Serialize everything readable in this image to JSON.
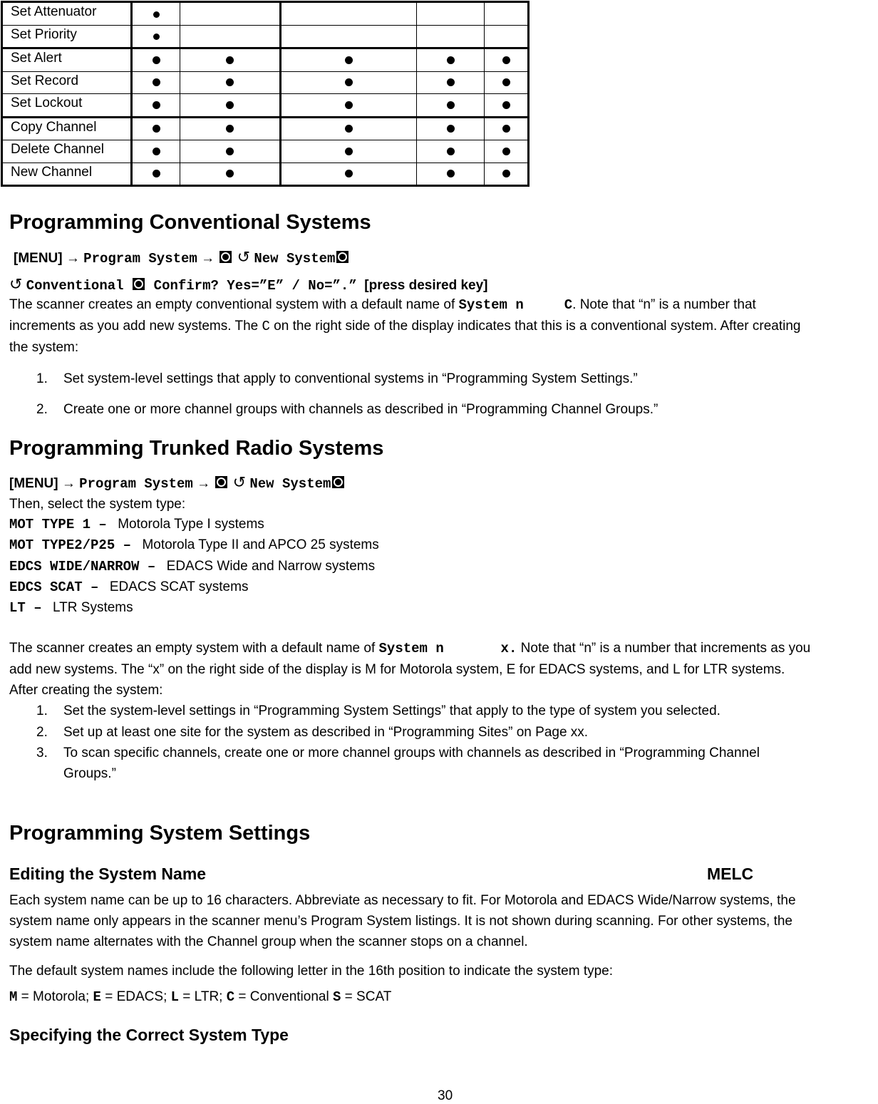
{
  "feature_table": {
    "rows": [
      {
        "label": "Set Attenuator",
        "marks": [
          true,
          false,
          false,
          false,
          false
        ],
        "small": true
      },
      {
        "label": "Set Priority",
        "marks": [
          true,
          false,
          false,
          false,
          false
        ],
        "small": true
      },
      {
        "label": "Set Alert",
        "marks": [
          true,
          true,
          true,
          true,
          true
        ]
      },
      {
        "label": "Set Record",
        "marks": [
          true,
          true,
          true,
          true,
          true
        ]
      },
      {
        "label": "Set Lockout",
        "marks": [
          true,
          true,
          true,
          true,
          true
        ]
      },
      {
        "label": "Copy Channel",
        "marks": [
          true,
          true,
          true,
          true,
          true
        ]
      },
      {
        "label": "Delete Channel",
        "marks": [
          true,
          true,
          true,
          true,
          true
        ]
      },
      {
        "label": "New Channel",
        "marks": [
          true,
          true,
          true,
          true,
          true
        ]
      }
    ]
  },
  "conventional": {
    "heading": "Programming Conventional Systems",
    "menu_key": "[MENU]",
    "arrow": "→",
    "path1": "Program System",
    "path2": "New System",
    "path3": "Conventional",
    "path4": "Confirm? Yes=”E” / No=”.”",
    "press_hint": "[press desired key]",
    "rotate_icon": "↺",
    "para_l1_a": "The scanner creates an empty conventional system with a default name of ",
    "para_l1_code": "System n     C",
    "para_l1_b": ".  Note that “n” is a number that",
    "para_l2_a": "increments as you add new systems. The ",
    "para_l2_code": "C",
    "para_l2_b": " on the right side of the display indicates that this is a conventional system. After creating",
    "para_l3": "the system:",
    "steps": [
      {
        "num": "1.",
        "text": "Set system-level settings that apply to conventional systems in “Programming System Settings.”"
      },
      {
        "num": "2.",
        "text": "Create one or more channel groups with channels as described in “Programming Channel Groups.”"
      }
    ]
  },
  "trunked": {
    "heading": "Programming Trunked Radio Systems",
    "menu_key": "[MENU]",
    "arrow": "→",
    "path1": "Program System",
    "path2": "New System",
    "rotate_icon": "↺",
    "intro": "Then, select the system type:",
    "types": [
      {
        "code": "MOT TYPE 1 – ",
        "desc": "Motorola Type I systems"
      },
      {
        "code": "MOT TYPE2/P25 – ",
        "desc": "Motorola Type II and APCO 25 systems"
      },
      {
        "code": "EDCS WIDE/NARROW – ",
        "desc": "EDACS Wide and Narrow systems"
      },
      {
        "code": "EDCS SCAT – ",
        "desc": "EDACS SCAT systems"
      },
      {
        "code": "LT – ",
        "desc": "LTR Systems"
      }
    ],
    "para_l1_a": "The scanner creates an empty system with a default name of ",
    "para_l1_code": "System n       x.",
    "para_l1_b": " Note that “n” is a number that increments as you",
    "para_l2": "add new systems. The “x” on the right side of the display is M for Motorola system, E for EDACS systems, and L for LTR systems.",
    "para_l3": "After creating the system:",
    "steps": [
      {
        "num": "1.",
        "text": "Set the system-level settings in “Programming System Settings” that apply to the type of system you selected."
      },
      {
        "num": "2.",
        "text": "Set up at least one site for the system as described in “Programming Sites” on Page xx."
      },
      {
        "num": "3.",
        "text": "To scan specific channels, create one or more channel groups with channels as described in “Programming Channel",
        "cont": "Groups.”"
      }
    ]
  },
  "system_settings": {
    "heading": "Programming System Settings",
    "sub1": "Editing the System Name",
    "sub1_tag": "MELC",
    "para1": [
      "Each system name can be up to 16 characters. Abbreviate as necessary to fit. For Motorola and EDACS Wide/Narrow systems, the",
      "system name only appears in the scanner menu’s Program System listings. It is not shown during scanning. For other systems, the",
      "system name alternates with the Channel group when the scanner stops on a channel."
    ],
    "para2": "The default system names include the following letter in the 16th position to indicate the system type:",
    "legend": [
      {
        "code": "M",
        "desc": " = Motorola; "
      },
      {
        "code": "E",
        "desc": " = EDACS; "
      },
      {
        "code": "L",
        "desc": " = LTR; "
      },
      {
        "code": "C",
        "desc": " = Conventional "
      },
      {
        "code": "S",
        "desc": " = SCAT"
      }
    ],
    "sub2": "Specifying the Correct System Type"
  },
  "page_number": "30"
}
